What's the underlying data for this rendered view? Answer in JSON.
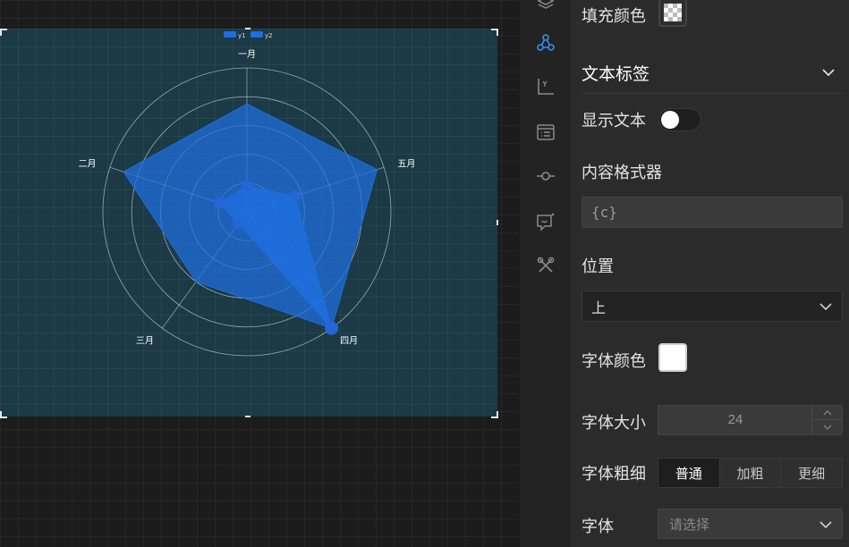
{
  "chart_data": {
    "type": "radar",
    "indicators": [
      "一月",
      "五月",
      "四月",
      "三月",
      "二月"
    ],
    "max": 100,
    "series": [
      {
        "name": "y1",
        "values": [
          75,
          95,
          100,
          60,
          90
        ]
      },
      {
        "name": "y2",
        "values": [
          18,
          35,
          100,
          10,
          20
        ]
      }
    ],
    "legend": [
      "y1",
      "y2"
    ],
    "legend_position": "top",
    "color": "#1e6fe0",
    "fill_opacity": 0.72
  },
  "properties": {
    "fill_color_label": "填充颜色",
    "text_label_section": "文本标签",
    "show_text_label": "显示文本",
    "show_text_on": false,
    "formatter_label": "内容格式器",
    "formatter_value": "{c}",
    "position_label": "位置",
    "position_value": "上",
    "font_color_label": "字体颜色",
    "font_color": "#ffffff",
    "font_size_label": "字体大小",
    "font_size_value": "24",
    "font_weight_label": "字体粗细",
    "font_weight_options": [
      "普通",
      "加粗",
      "更细"
    ],
    "font_weight_selected": "普通",
    "font_family_label": "字体",
    "font_family_placeholder": "请选择"
  },
  "toolbar_icons": [
    "layers-icon",
    "radar-chart-icon",
    "axis-icon",
    "legend-list-icon",
    "data-point-icon",
    "tooltip-icon",
    "tools-icon"
  ]
}
